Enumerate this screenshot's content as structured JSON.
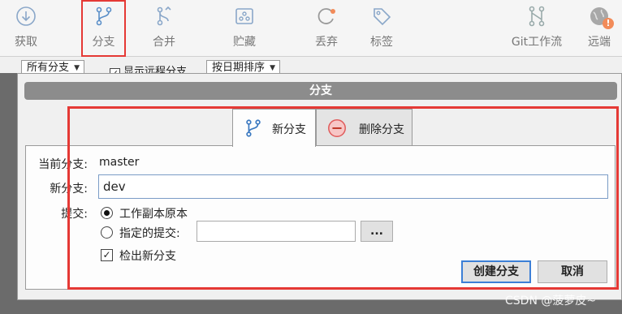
{
  "toolbar": {
    "items": [
      {
        "label": "获取",
        "icon": "fetch-icon"
      },
      {
        "label": "分支",
        "icon": "branch-icon",
        "active": true
      },
      {
        "label": "合并",
        "icon": "merge-icon"
      },
      {
        "label": "贮藏",
        "icon": "stash-icon"
      },
      {
        "label": "丢弃",
        "icon": "discard-icon"
      },
      {
        "label": "标签",
        "icon": "tag-icon"
      },
      {
        "label": "Git工作流",
        "icon": "git-flow-icon"
      },
      {
        "label": "远端",
        "icon": "remote-icon",
        "badge": "!"
      }
    ]
  },
  "filterbar": {
    "branch_select": "所有分支",
    "show_remote_label": "显示远程分支",
    "show_remote_checked": true,
    "sort_select": "按日期排序"
  },
  "dialog": {
    "title": "分支",
    "tabs": [
      {
        "label": "新分支",
        "icon": "branch-icon",
        "selected": true
      },
      {
        "label": "删除分支",
        "icon": "minus-circle-icon",
        "selected": false
      }
    ],
    "current_branch_label": "当前分支:",
    "current_branch_value": "master",
    "new_branch_label": "新分支:",
    "new_branch_value": "dev",
    "commit_label": "提交:",
    "option_working_copy": "工作副本原本",
    "option_specified": "指定的提交:",
    "specified_value": "",
    "browse_button": "...",
    "checkout_label": "检出新分支",
    "checkout_checked": true,
    "create_button": "创建分支",
    "cancel_button": "取消"
  },
  "watermark": "CSDN @菠萝皮~",
  "colors": {
    "highlight": "#e53935",
    "accent": "#3c7fd6",
    "title_bar": "#8c8c8c"
  }
}
